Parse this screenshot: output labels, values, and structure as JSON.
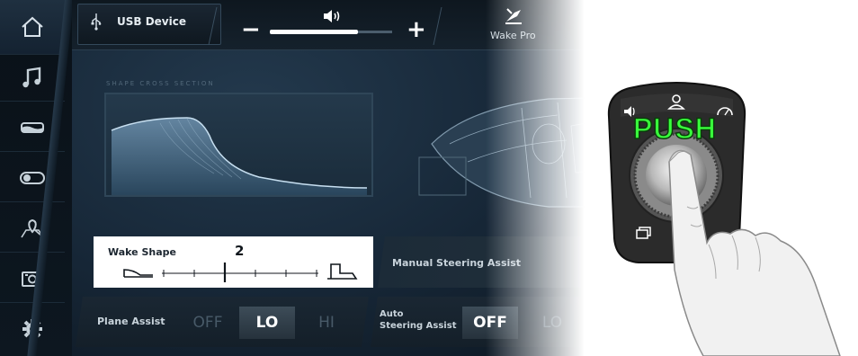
{
  "header": {
    "usb_label": "USB Device",
    "volume_minus": "−",
    "volume_plus": "+",
    "volume_level": 0.72,
    "wake_label": "Wake Pro"
  },
  "sidebar": {
    "items": [
      {
        "icon": "home-icon"
      },
      {
        "icon": "music-icon"
      },
      {
        "icon": "boat-icon"
      },
      {
        "icon": "toggle-icon"
      },
      {
        "icon": "map-pin-icon"
      },
      {
        "icon": "camera-icon"
      },
      {
        "icon": "gear-icon"
      }
    ]
  },
  "main": {
    "section_label": "SHAPE CROSS SECTION",
    "wake_shape": {
      "label": "Wake Shape",
      "value": "2"
    },
    "manual_steering": {
      "label": "Manual Steering Assist"
    },
    "plane_assist": {
      "label": "Plane Assist",
      "options": [
        "OFF",
        "LO",
        "HI"
      ],
      "selected": "LO"
    },
    "auto_steering": {
      "label_line1": "Auto",
      "label_line2": "Steering Assist",
      "options": [
        "OFF",
        "LO"
      ],
      "selected": "OFF"
    }
  },
  "controller": {
    "push_label": "PUSH",
    "icons": [
      "volume-icon",
      "profile-icon",
      "gauge-icon",
      "screens-icon"
    ]
  },
  "colors": {
    "push_green": "#39ff3c",
    "screen_bg": "#162636",
    "selected_option": "#ffffff",
    "inactive_option": "#485a68"
  }
}
